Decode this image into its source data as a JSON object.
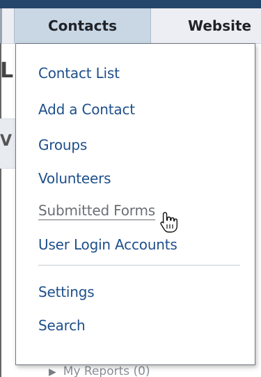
{
  "nav": {
    "tabs": [
      {
        "label": "Contacts"
      },
      {
        "label": "Website"
      }
    ]
  },
  "dropdown": {
    "items": [
      {
        "label": "Contact List"
      },
      {
        "label": "Add a Contact"
      },
      {
        "label": "Groups"
      },
      {
        "label": "Volunteers"
      },
      {
        "label": "Submitted Forms"
      },
      {
        "label": "User Login Accounts"
      },
      {
        "label": "Settings"
      },
      {
        "label": "Search"
      }
    ]
  },
  "background": {
    "letter_top": "L",
    "letter_side": "V",
    "footer_text": "My Reports (0)"
  },
  "colors": {
    "link": "#1e4f8b",
    "hover_link": "#6b6f75",
    "active_tab": "#c9d6e4",
    "navbar": "#eceef4",
    "top_strip": "#23466a"
  },
  "icons": {
    "cursor": "hand-pointer-icon",
    "footer_arrow": "triangle-right-icon"
  }
}
